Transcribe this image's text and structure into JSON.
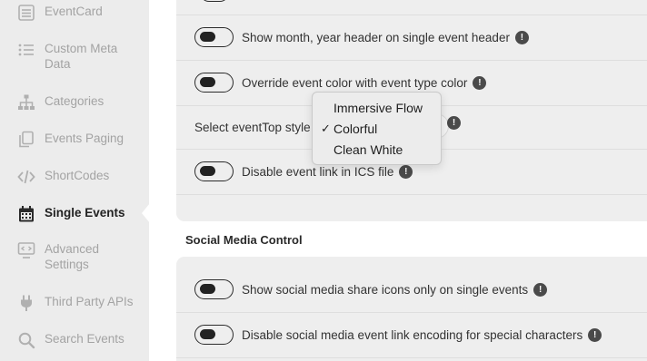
{
  "sidebar": {
    "items": [
      {
        "label": "EventCard",
        "icon": "list-icon",
        "active": false
      },
      {
        "label": "Custom Meta Data",
        "icon": "bullet-list-icon",
        "active": false
      },
      {
        "label": "Categories",
        "icon": "hierarchy-icon",
        "active": false
      },
      {
        "label": "Events Paging",
        "icon": "copy-pages-icon",
        "active": false
      },
      {
        "label": "ShortCodes",
        "icon": "code-icon",
        "active": false
      },
      {
        "label": "Single Events",
        "icon": "calendar-icon",
        "active": true
      },
      {
        "label": "Advanced Settings",
        "icon": "monitor-code-icon",
        "active": false
      },
      {
        "label": "Third Party APIs",
        "icon": "plug-icon",
        "active": false
      },
      {
        "label": "Search Events",
        "icon": "search-icon",
        "active": false
      }
    ]
  },
  "settings_panel": {
    "rows": [
      {
        "label": "Show month, year header on single event header",
        "type": "toggle",
        "on": false
      },
      {
        "label": "Override event color with event type color",
        "type": "toggle",
        "on": false
      },
      {
        "label": "Select eventTop style",
        "type": "select"
      },
      {
        "label": "Disable event link in ICS file",
        "type": "toggle",
        "on": false
      }
    ]
  },
  "eventtop_style_dropdown": {
    "options": [
      "Immersive Flow",
      "Colorful",
      "Clean White"
    ],
    "selected": "Colorful",
    "check_mark": "✓"
  },
  "social_section": {
    "title": "Social Media Control",
    "rows": [
      {
        "label": "Show social media share icons only on single events",
        "type": "toggle",
        "on": false
      },
      {
        "label": "Disable social media event link encoding for special characters",
        "type": "toggle",
        "on": false
      }
    ]
  },
  "info_glyph": "!",
  "colors": {
    "sidebar_bg": "#ececec",
    "panel_bg": "#eeeeee",
    "muted_text": "#a3a3a3",
    "active_text": "#222222"
  }
}
